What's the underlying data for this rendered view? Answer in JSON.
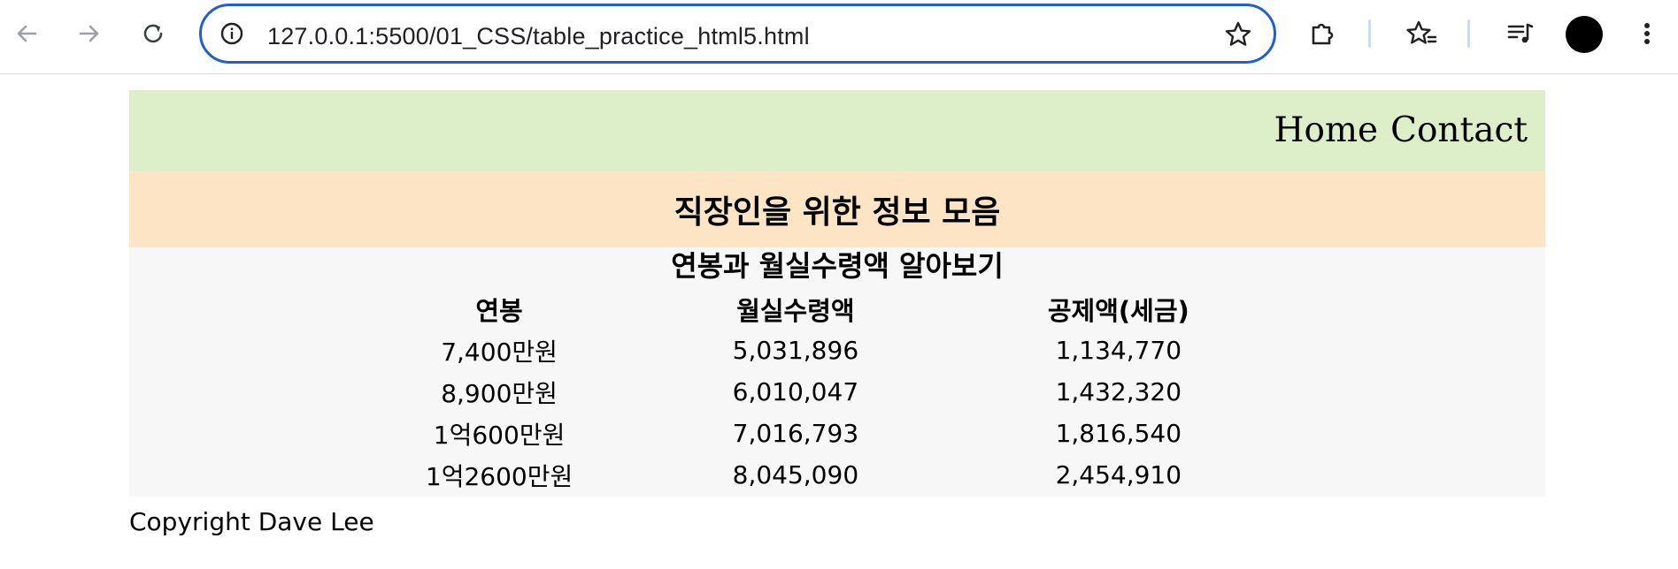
{
  "browser": {
    "url": "127.0.0.1:5500/01_CSS/table_practice_html5.html",
    "icons": {
      "back": "arrow-left-icon",
      "forward": "arrow-right-icon",
      "reload": "reload-icon",
      "info": "info-icon",
      "bookmark": "star-icon",
      "extensions": "puzzle-icon",
      "favorites": "star-list-icon",
      "media": "media-queue-icon",
      "menu": "kebab-menu-icon"
    },
    "accent": "#1f5fcf"
  },
  "nav": {
    "home": "Home",
    "contact": "Contact",
    "background": "#ddefc9"
  },
  "hero": {
    "title": "직장인을 위한 정보 모음",
    "background": "#fde4c5"
  },
  "table": {
    "caption": "연봉과 월실수령액 알아보기",
    "headers": [
      "연봉",
      "월실수령액",
      "공제액(세금)"
    ],
    "rows": [
      [
        "7,400만원",
        "5,031,896",
        "1,134,770"
      ],
      [
        "8,900만원",
        "6,010,047",
        "1,432,320"
      ],
      [
        "1억600만원",
        "7,016,793",
        "1,816,540"
      ],
      [
        "1억2600만원",
        "8,045,090",
        "2,454,910"
      ]
    ]
  },
  "footer": {
    "text": "Copyright Dave Lee"
  }
}
